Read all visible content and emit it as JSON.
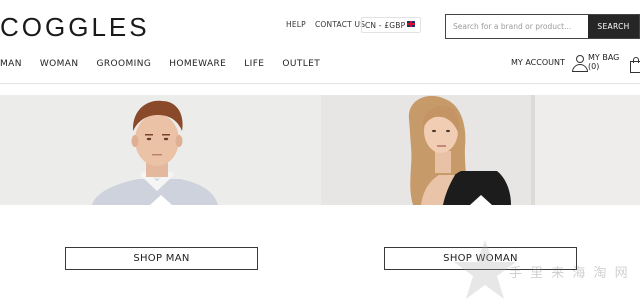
{
  "brand": {
    "logo": "COGGLES"
  },
  "utility": {
    "help": "HELP",
    "contact": "CONTACT US",
    "currency": "CN - £GBP"
  },
  "search": {
    "placeholder": "Search for a brand or product...",
    "button": "SEARCH"
  },
  "nav": {
    "items": [
      "MAN",
      "WOMAN",
      "GROOMING",
      "HOMEWARE",
      "LIFE",
      "OUTLET"
    ]
  },
  "account": {
    "label": "MY ACCOUNT"
  },
  "bag": {
    "label": "MY BAG (0)"
  },
  "hero": {
    "man_cta": "SHOP MAN",
    "woman_cta": "SHOP WOMAN"
  },
  "watermark": {
    "text": "手 里 来 海 淘 网"
  },
  "colors": {
    "header_text": "#222222",
    "search_button_bg": "#262626",
    "hero_bg": "#ececeb"
  },
  "icons": [
    "flag-icon",
    "user-icon",
    "bag-icon",
    "star-watermark-icon"
  ]
}
